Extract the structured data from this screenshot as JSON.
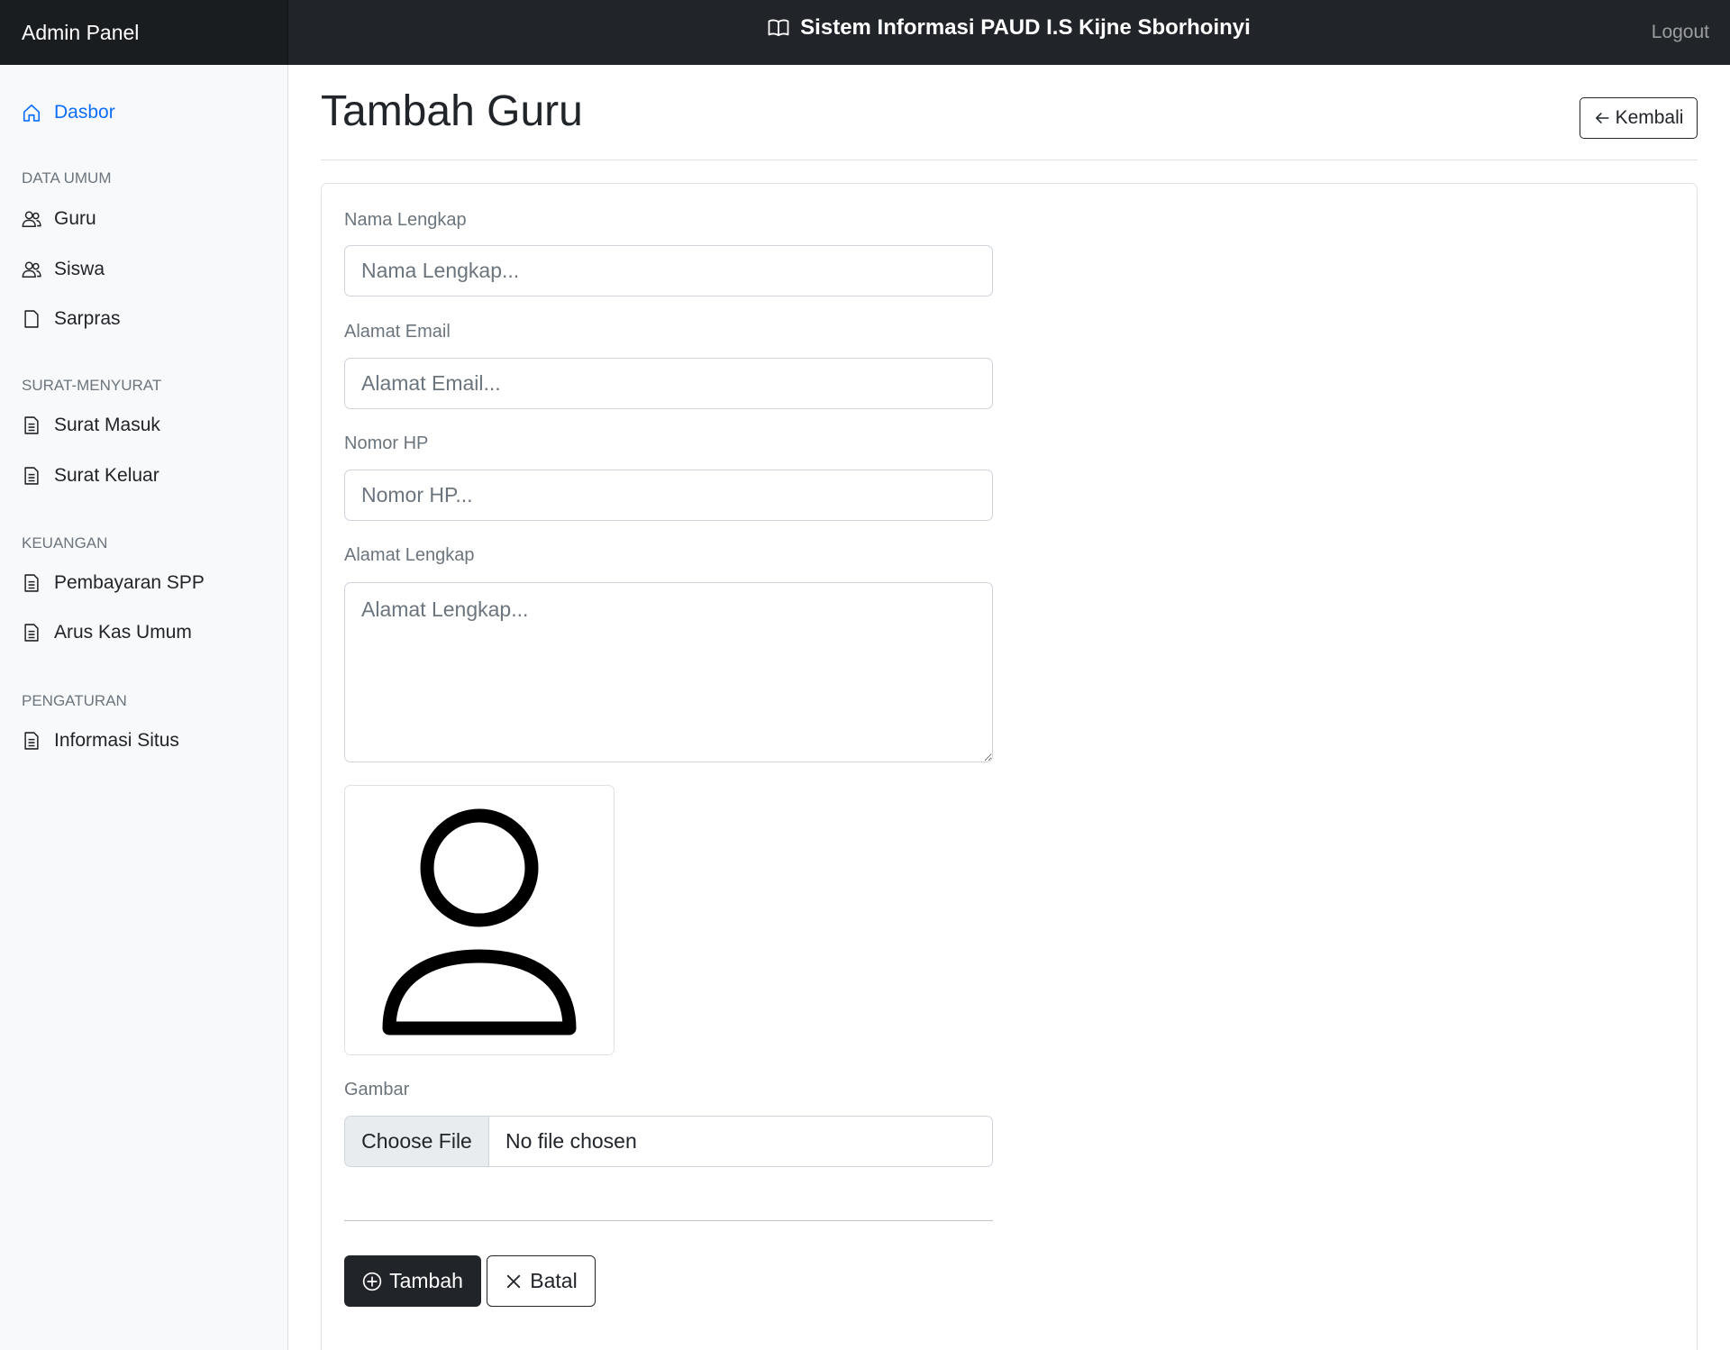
{
  "navbar": {
    "brand": "Admin Panel",
    "site_title": "Sistem Informasi PAUD I.S Kijne Sborhoinyi",
    "logout": "Logout"
  },
  "sidebar": {
    "dashboard": "Dasbor",
    "sections": [
      {
        "heading": "DATA UMUM",
        "items": [
          "Guru",
          "Siswa",
          "Sarpras"
        ]
      },
      {
        "heading": "SURAT-MENYURAT",
        "items": [
          "Surat Masuk",
          "Surat Keluar"
        ]
      },
      {
        "heading": "KEUANGAN",
        "items": [
          "Pembayaran SPP",
          "Arus Kas Umum"
        ]
      },
      {
        "heading": "PENGATURAN",
        "items": [
          "Informasi Situs"
        ]
      }
    ]
  },
  "page": {
    "title": "Tambah Guru",
    "back_label": "Kembali"
  },
  "form": {
    "name": {
      "label": "Nama Lengkap",
      "placeholder": "Nama Lengkap..."
    },
    "email": {
      "label": "Alamat Email",
      "placeholder": "Alamat Email..."
    },
    "phone": {
      "label": "Nomor HP",
      "placeholder": "Nomor HP..."
    },
    "address": {
      "label": "Alamat Lengkap",
      "placeholder": "Alamat Lengkap..."
    },
    "image": {
      "label": "Gambar",
      "button": "Choose File",
      "status": "No file chosen"
    },
    "submit_label": "Tambah",
    "cancel_label": "Batal"
  },
  "colors": {
    "navbar_bg": "#212529",
    "sidebar_bg": "#f8f9fa",
    "active_link": "#0d6efd",
    "primary_button": "#212529"
  }
}
